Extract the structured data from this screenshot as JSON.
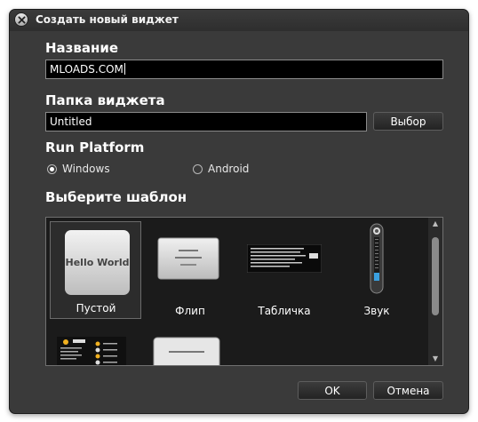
{
  "window": {
    "title": "Создать новый виджет"
  },
  "name_section": {
    "label": "Название",
    "value": "MLOADS.COM"
  },
  "folder_section": {
    "label": "Папка виджета",
    "value": "Untitled",
    "browse_label": "Выбор"
  },
  "platform_section": {
    "label": "Run Platform",
    "options": [
      {
        "label": "Windows",
        "selected": true
      },
      {
        "label": "Android",
        "selected": false
      }
    ]
  },
  "template_section": {
    "label": "Выберите шаблон",
    "items": [
      {
        "label": "Пустой",
        "preview_text": "Hello World",
        "selected": true
      },
      {
        "label": "Флип",
        "selected": false
      },
      {
        "label": "Табличка",
        "selected": false
      },
      {
        "label": "Звук",
        "selected": false
      }
    ]
  },
  "footer": {
    "ok_label": "OK",
    "cancel_label": "Отмена"
  },
  "colors": {
    "window_bg": "#3a3a3a",
    "field_bg": "#000000",
    "text": "#ffffff"
  }
}
